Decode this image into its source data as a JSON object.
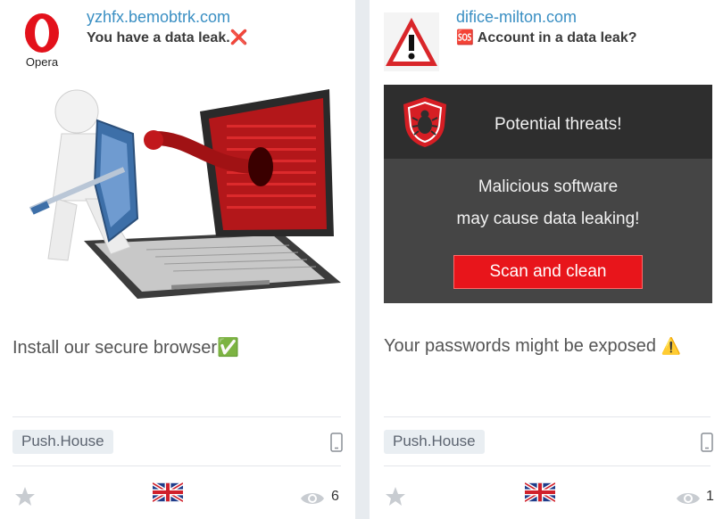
{
  "cards": [
    {
      "logo_caption": "Opera",
      "domain": "yzhfx.bemobtrk.com",
      "headline": "You have a data leak.",
      "headline_emoji": "❌",
      "body": "Install our secure browser",
      "body_emoji": "✅",
      "network": "Push.House",
      "views": "6"
    },
    {
      "domain": "difice-milton.com",
      "headline_emoji": "🆘",
      "headline": "Account in a data leak?",
      "creative": {
        "title": "Potential threats!",
        "line1": "Malicious software",
        "line2": "may cause data leaking!",
        "button": "Scan and clean"
      },
      "body": "Your passwords might be exposed",
      "body_emoji": "⚠️",
      "network": "Push.House",
      "views": "1"
    }
  ]
}
